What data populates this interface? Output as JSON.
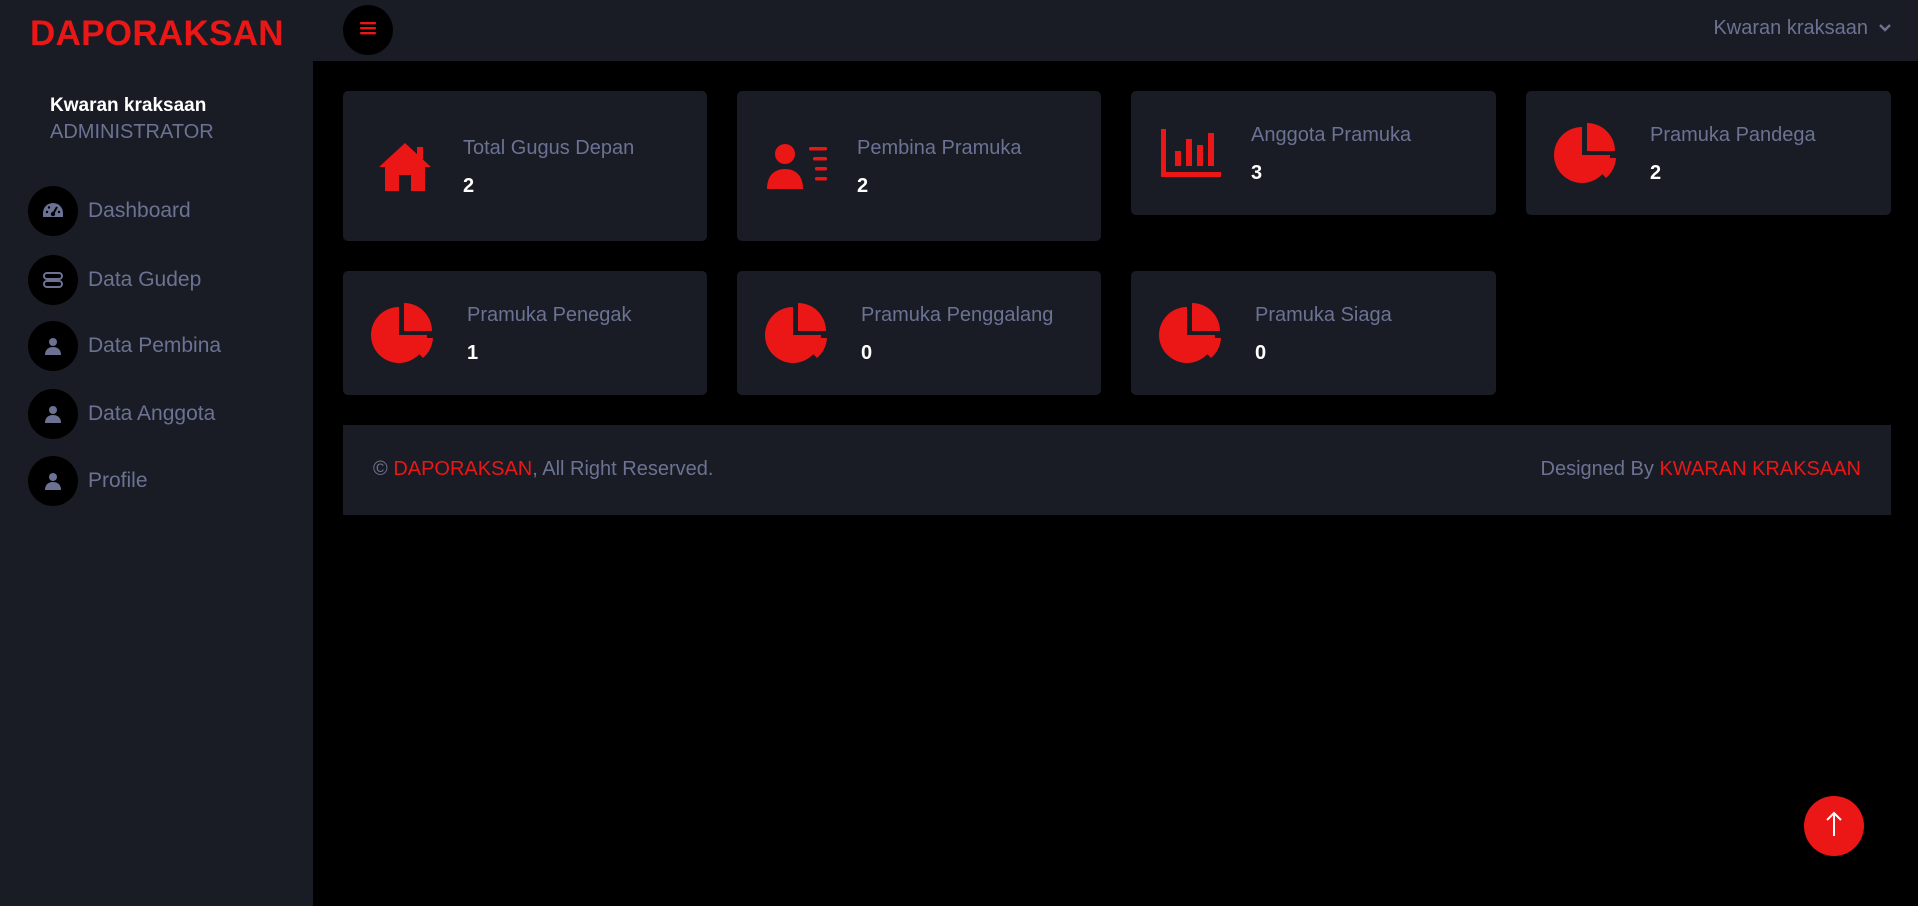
{
  "app": {
    "brand": "DAPORAKSAN",
    "accent_color": "#eb1616"
  },
  "sidebar": {
    "user": {
      "name": "Kwaran kraksaan",
      "role": "ADMINISTRATOR"
    },
    "items": [
      {
        "label": "Dashboard",
        "icon": "speedometer-icon"
      },
      {
        "label": "Data Gudep",
        "icon": "database-icon"
      },
      {
        "label": "Data Pembina",
        "icon": "user-icon"
      },
      {
        "label": "Data Anggota",
        "icon": "user-icon"
      },
      {
        "label": "Profile",
        "icon": "user-icon"
      }
    ]
  },
  "topbar": {
    "account_name": "Kwaran kraksaan",
    "menu_icon": "bars-icon",
    "account_icon": "chevron-down-icon"
  },
  "stats": [
    {
      "title": "Total Gugus Depan",
      "value": "2",
      "icon": "home-icon"
    },
    {
      "title": "Pembina Pramuka",
      "value": "2",
      "icon": "user-list-icon"
    },
    {
      "title": "Anggota Pramuka",
      "value": "3",
      "icon": "bar-chart-icon"
    },
    {
      "title": "Pramuka Pandega",
      "value": "2",
      "icon": "pie-chart-icon"
    },
    {
      "title": "Pramuka Penegak",
      "value": "1",
      "icon": "pie-chart-icon"
    },
    {
      "title": "Pramuka Penggalang",
      "value": "0",
      "icon": "pie-chart-icon"
    },
    {
      "title": "Pramuka Siaga",
      "value": "0",
      "icon": "pie-chart-icon"
    }
  ],
  "footer": {
    "copyright_symbol": "©",
    "brand": "DAPORAKSAN",
    "rights": ", All Right Reserved.",
    "designed_by": "Designed By",
    "designer": "KWARAN KRAKSAAN"
  },
  "back_to_top": {
    "icon": "arrow-up-icon"
  }
}
